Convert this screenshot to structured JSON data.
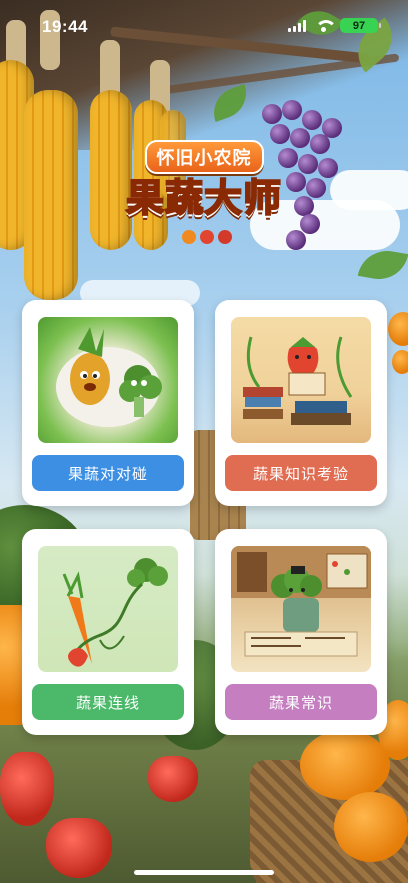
{
  "status_bar": {
    "time": "19:44",
    "battery": "97"
  },
  "logo": {
    "subtitle": "怀旧小农院",
    "title": "果蔬大师"
  },
  "menu": {
    "items": [
      {
        "label": "果蔬对对碰",
        "color": "#3c8fe2",
        "icon": "pineapple-broccoli-illustration"
      },
      {
        "label": "蔬果知识考验",
        "color": "#e06c52",
        "icon": "strawberry-reading-illustration"
      },
      {
        "label": "蔬果连线",
        "color": "#4bb86a",
        "icon": "carrot-broccoli-vine-illustration"
      },
      {
        "label": "蔬果常识",
        "color": "#c57ec0",
        "icon": "broccoli-scholar-illustration"
      }
    ]
  }
}
